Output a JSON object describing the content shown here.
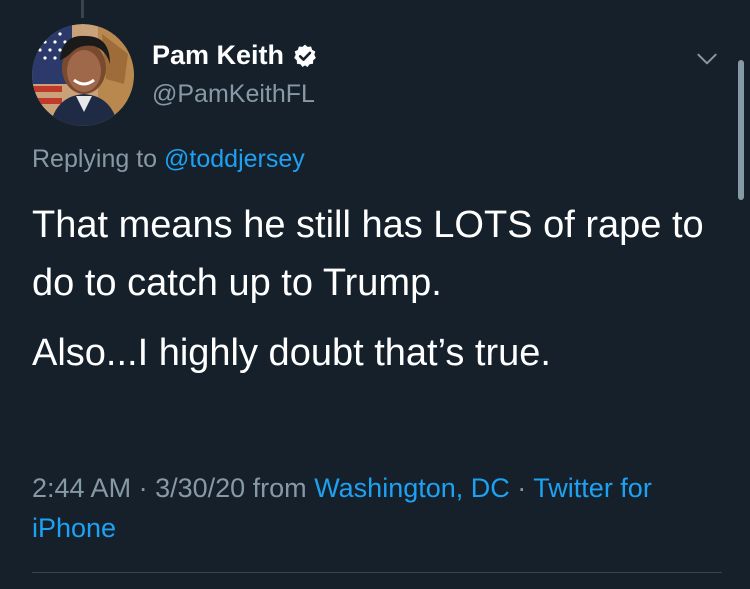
{
  "tweet": {
    "author": {
      "name": "Pam Keith",
      "handle": "@PamKeithFL",
      "verified": true
    },
    "replying_prefix": "Replying to",
    "replying_to": "@toddjersey",
    "paragraphs": [
      "That means he still has LOTS of rape to do to catch up to Trump.",
      "Also...I highly doubt that’s true."
    ],
    "time": "2:44 AM",
    "date": "3/30/20",
    "sep": " · ",
    "from_label": "from",
    "location": "Washington, DC",
    "source": "Twitter for iPhone"
  },
  "icons": {
    "verified": "verified-badge-icon",
    "menu": "chevron-down-icon"
  },
  "colors": {
    "background": "#15202b",
    "accent": "#1da1f2",
    "secondary_text": "#8899a6",
    "primary_text": "#ffffff"
  }
}
